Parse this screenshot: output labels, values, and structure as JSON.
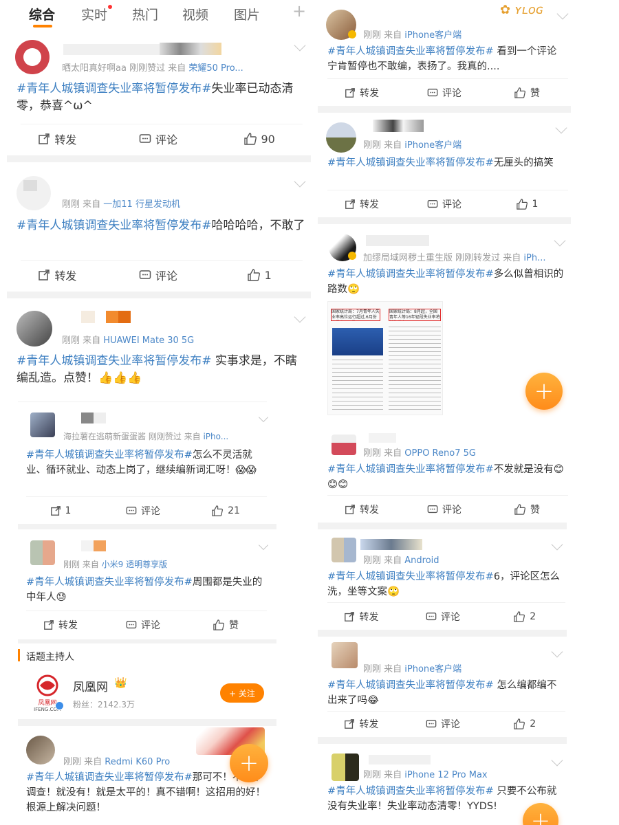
{
  "tabs": [
    "综合",
    "实时",
    "热门",
    "视频",
    "图片"
  ],
  "add_glyph": "+",
  "hashtag": "#青年人城镇调查失业率将暂停发布#",
  "labels": {
    "repost": "转发",
    "comment": "评论",
    "like": "赞"
  },
  "left_posts": [
    {
      "meta": "晒太阳真好啊aa 刚刚赞过  来自",
      "source": "荣耀50 Pro...",
      "body": "失业率已动态清零，恭喜^ω^",
      "likes": "90"
    },
    {
      "meta": "刚刚  来自",
      "source": "一加11 行星发动机",
      "body": "哈哈哈哈，不敢了",
      "likes": "1"
    },
    {
      "meta": "刚刚  来自",
      "source": "HUAWEI Mate 30 5G",
      "body": " 实事求是，不瞎编乱造。点赞！👍👍👍"
    }
  ],
  "left_nested": [
    {
      "meta": "海拉薯在逃萌新蛋蛋酱 刚刚赞过  来自",
      "source": "iPho...",
      "body": "怎么不灵活就业、循环就业、动态上岗了，继续编新词汇呀！😱😱",
      "reposts": "1",
      "likes": "21"
    },
    {
      "meta": "刚刚  来自",
      "source": "小米9 透明尊享版",
      "body": "周围都是失业的中年人😓"
    }
  ],
  "host": {
    "section_title": "话题主持人",
    "name": "凤凰网",
    "crown": "👑",
    "fans": "粉丝：2142.3万",
    "follow": "+ 关注",
    "logo_cn": "凤凰网",
    "logo_en": "IFENG.COM"
  },
  "left_last": {
    "meta": "刚刚  来自",
    "source": "Redmi K60 Pro",
    "body": "那可不！不要不调查！就没有！就是太平的！真不错啊！这招用的好！根源上解决问题！"
  },
  "right_posts": [
    {
      "meta": "刚刚  来自",
      "source": "iPhone客户端",
      "body": " 看到一个评论 宁肯暂停也不敢编，表扬了。我真的...."
    },
    {
      "meta": "刚刚  来自",
      "source": "iPhone客户端",
      "body": "无厘头的搞笑",
      "likes": "1"
    },
    {
      "meta": "加缪局域网秽土重生版 刚刚转发过  来自",
      "source": "iPh...",
      "body": "多么似曾相识的路数🙄"
    },
    {
      "meta": "刚刚  来自",
      "source": "OPPO Reno7 5G",
      "body": "不发就是没有😊😊😊"
    },
    {
      "meta": "刚刚  来自",
      "source": "Android",
      "body": "6，评论区怎么洗，坐等文案🙄",
      "likes": "2"
    },
    {
      "meta": "刚刚  来自",
      "source": "iPhone客户端",
      "body": " 怎么编都编不出来了吗😂",
      "likes": "2"
    },
    {
      "meta": "刚刚  来自",
      "source": "iPhone 12 Pro Max",
      "body": " 只要不公布就没有失业率！失业率动态清零！YYDS!"
    }
  ],
  "news_image": {
    "left_caption": "国家统计局：7月青年人失业率高位运行超过,6月份达最高于下降",
    "right_caption": "国家统计局：8月起，全国青年人等16年轻段失业率将暂停发布"
  },
  "fab_glyph": "+"
}
